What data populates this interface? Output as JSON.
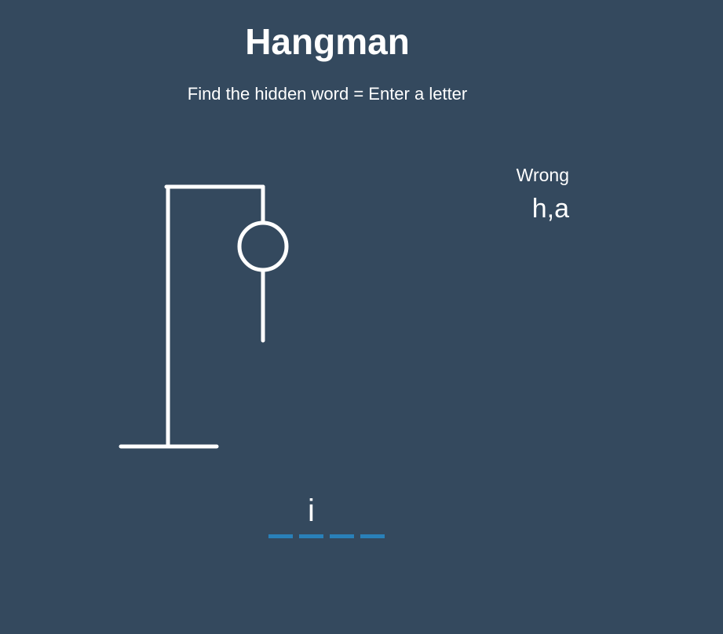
{
  "header": {
    "title": "Hangman",
    "subtitle": "Find the hidden word = Enter a letter"
  },
  "figure": {
    "parts_shown": [
      "base",
      "pole",
      "beam",
      "rope",
      "head",
      "body"
    ]
  },
  "wrong": {
    "label": "Wrong",
    "letters": "h,a"
  },
  "word": {
    "slots": [
      "",
      "i",
      "",
      ""
    ]
  },
  "colors": {
    "background": "#34495e",
    "text": "#ffffff",
    "slot_underline": "#2980b9"
  }
}
